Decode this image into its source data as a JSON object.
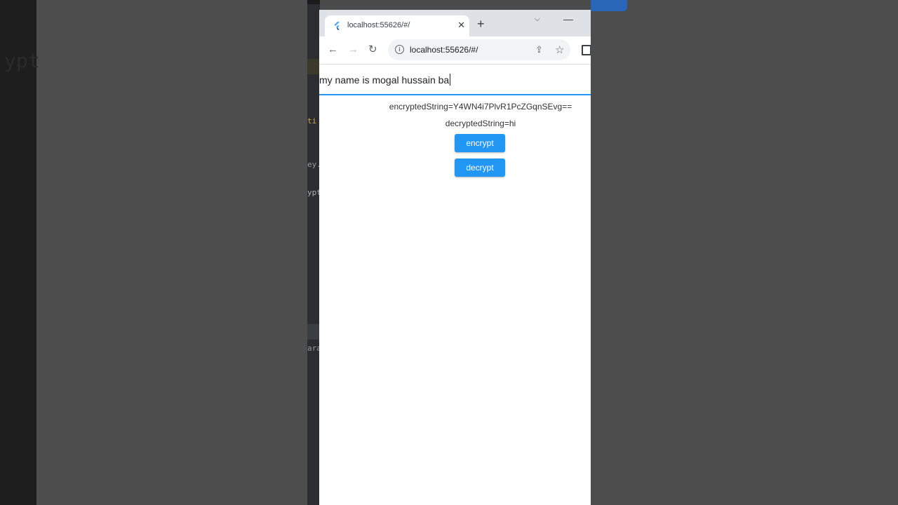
{
  "background": {
    "ghost_text": "ypt"
  },
  "editor_strip": {
    "snippets": [
      "ti",
      "ey.",
      "ypt",
      "ara"
    ]
  },
  "browser": {
    "tab": {
      "title": "localhost:55626/#/",
      "close_glyph": "✕"
    },
    "new_tab_glyph": "+",
    "tab_search_glyph": "⌵",
    "minimize_glyph": "—",
    "toolbar": {
      "back_glyph": "←",
      "forward_glyph": "→",
      "reload_glyph": "↻",
      "url": "localhost:55626/#/",
      "share_glyph": "⇪",
      "bookmark_glyph": "☆"
    }
  },
  "app": {
    "input_value": "my name is mogal hussain ba",
    "encrypted_text": "encryptedString=Y4WN4i7PlvR1PcZGqnSEvg==",
    "decrypted_text": "decryptedString=hi",
    "encrypt_label": "encrypt",
    "decrypt_label": "decrypt"
  },
  "colors": {
    "accent": "#2196f3",
    "tabbar": "#dee1e6",
    "omnibox": "#f1f3f4"
  }
}
